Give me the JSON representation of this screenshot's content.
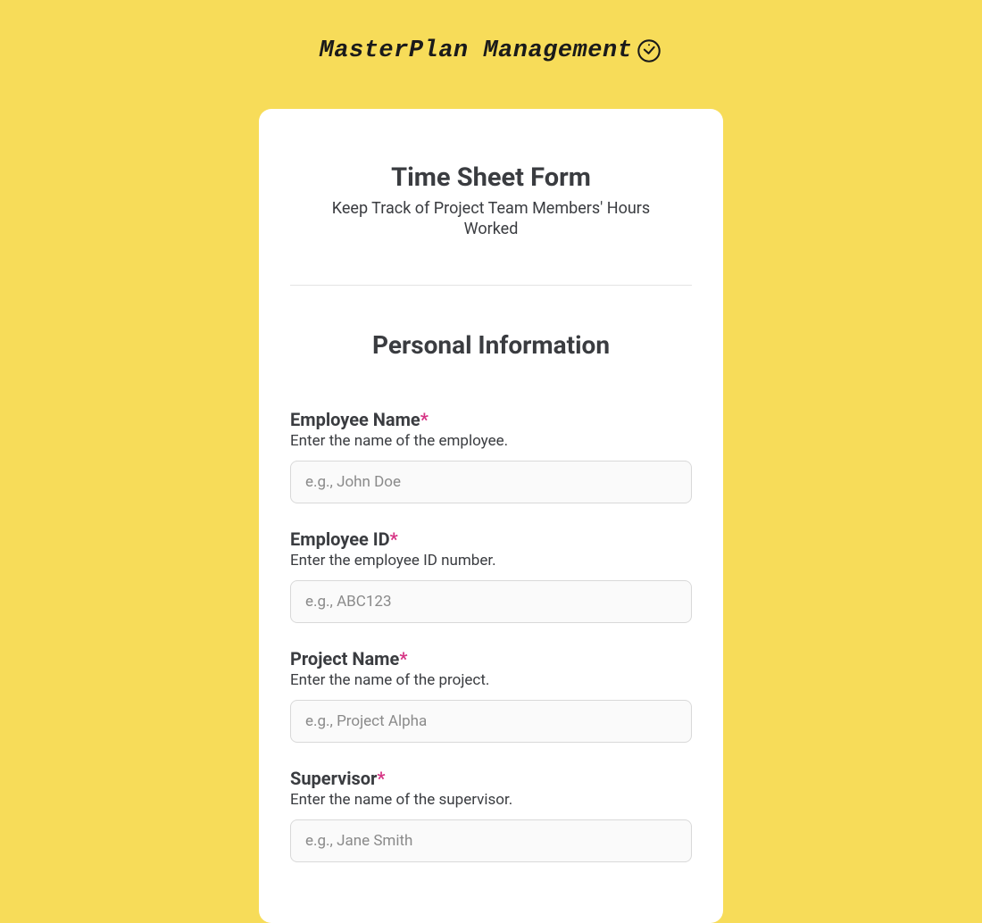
{
  "brand": {
    "title": "MasterPlan Management"
  },
  "form": {
    "title": "Time Sheet Form",
    "subtitle": "Keep Track of Project Team Members' Hours Worked"
  },
  "section": {
    "title": "Personal Information"
  },
  "required_mark": "*",
  "fields": {
    "employee_name": {
      "label": "Employee Name",
      "help": "Enter the name of the employee.",
      "placeholder": "e.g., John Doe",
      "value": ""
    },
    "employee_id": {
      "label": "Employee ID",
      "help": "Enter the employee ID number.",
      "placeholder": "e.g., ABC123",
      "value": ""
    },
    "project_name": {
      "label": "Project Name",
      "help": "Enter the name of the project.",
      "placeholder": "e.g., Project Alpha",
      "value": ""
    },
    "supervisor": {
      "label": "Supervisor",
      "help": "Enter the name of the supervisor.",
      "placeholder": "e.g., Jane Smith",
      "value": ""
    }
  }
}
